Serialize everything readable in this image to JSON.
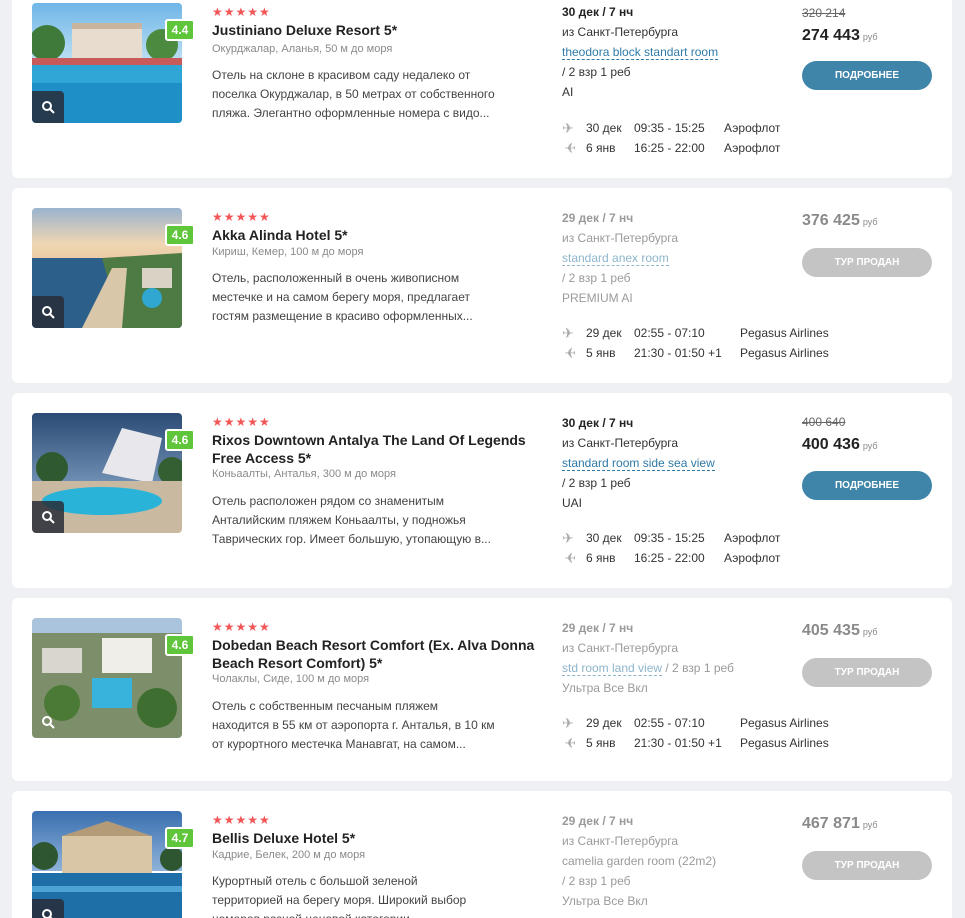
{
  "currency": "руб",
  "hotels": [
    {
      "stars": "★★★★★",
      "rating": "4.4",
      "name": "Justiniano Deluxe Resort 5*",
      "location": "Окурджалар, Аланья, 50 м до моря",
      "description": [
        "Отель на склоне в красивом саду недалеко от",
        "поселка Окурджалар, в 50 метрах от собственного",
        "пляжа. Элегантно оформленные номера с видо..."
      ],
      "date": "30 дек / 7 нч",
      "from": "из Санкт-Петербурга",
      "room": "theodora block standart room",
      "guests": "/ 2 взр 1 реб",
      "meal": "AI",
      "flights": [
        {
          "date": "30 дек",
          "time": "09:35 - 15:25",
          "airline": "Аэрофлот"
        },
        {
          "date": "6 янв",
          "time": "16:25 - 22:00",
          "airline": "Аэрофлот"
        }
      ],
      "old_price": "320 214",
      "price": "274 443",
      "button": "ПОДРОБНЕЕ"
    },
    {
      "stars": "★★★★★",
      "rating": "4.6",
      "name": "Akka Alinda Hotel 5*",
      "location": "Кириш, Кемер, 100 м до моря",
      "description": [
        "Отель, расположенный в очень живописном",
        "местечке и на самом берегу моря, предлагает",
        "гостям размещение в красиво оформленных..."
      ],
      "date": "29 дек / 7 нч",
      "from": "из Санкт-Петербурга",
      "room": "standard anex room",
      "guests": "/ 2 взр 1 реб",
      "meal": "PREMIUM AI",
      "flights": [
        {
          "date": "29 дек",
          "time": "02:55 - 07:10",
          "airline": "Pegasus Airlines"
        },
        {
          "date": "5 янв",
          "time": "21:30 - 01:50 +1",
          "airline": "Pegasus Airlines"
        }
      ],
      "price": "376 425",
      "button": "ТУР ПРОДАН"
    },
    {
      "stars": "★★★★★",
      "rating": "4.6",
      "name": "Rixos Downtown Antalya The Land Of Legends Free Access 5*",
      "location": "Коньаалты, Анталья, 300 м до моря",
      "description": [
        "Отель расположен рядом со знаменитым",
        "Анталийским пляжем Коньаалты, у подножья",
        "Таврических гор. Имеет большую, утопающую в..."
      ],
      "date": "30 дек / 7 нч",
      "from": "из Санкт-Петербурга",
      "room": "standard room side sea view",
      "guests": "/ 2 взр 1 реб",
      "meal": "UAI",
      "flights": [
        {
          "date": "30 дек",
          "time": "09:35 - 15:25",
          "airline": "Аэрофлот"
        },
        {
          "date": "6 янв",
          "time": "16:25 - 22:00",
          "airline": "Аэрофлот"
        }
      ],
      "old_price": "400 640",
      "price": "400 436",
      "button": "ПОДРОБНЕЕ"
    },
    {
      "stars": "★★★★★",
      "rating": "4.6",
      "name": "Dobedan Beach Resort Comfort (Ex. Alva Donna Beach Resort Comfort) 5*",
      "location": "Чолаклы, Сиде, 100 м до моря",
      "description": [
        "Отель с собственным песчаным пляжем",
        "находится в 55 км от аэропорта г. Анталья, в 10 км",
        "от курортного местечка Манавгат, на самом..."
      ],
      "date": "29 дек / 7 нч",
      "from": "из Санкт-Петербурга",
      "room": "std room land view",
      "guests": "/ 2 взр 1 реб",
      "meal": "Ультра Все Вкл",
      "flights": [
        {
          "date": "29 дек",
          "time": "02:55 - 07:10",
          "airline": "Pegasus Airlines"
        },
        {
          "date": "5 янв",
          "time": "21:30 - 01:50 +1",
          "airline": "Pegasus Airlines"
        }
      ],
      "price": "405 435",
      "button": "ТУР ПРОДАН"
    },
    {
      "stars": "★★★★★",
      "rating": "4.7",
      "name": "Bellis Deluxe Hotel 5*",
      "location": "Кадрие, Белек, 200 м до моря",
      "description": [
        "Курортный отель с большой зеленой",
        "территорией на берегу моря. Широкий выбор",
        "номеров разной ценовой категории..."
      ],
      "date": "29 дек / 7 нч",
      "from": "из Санкт-Петербурга",
      "room": "camelia garden room (22m2)",
      "guests": "/ 2 взр 1 реб",
      "meal": "Ультра Все Вкл",
      "price": "467 871",
      "button": "ТУР ПРОДАН"
    }
  ]
}
